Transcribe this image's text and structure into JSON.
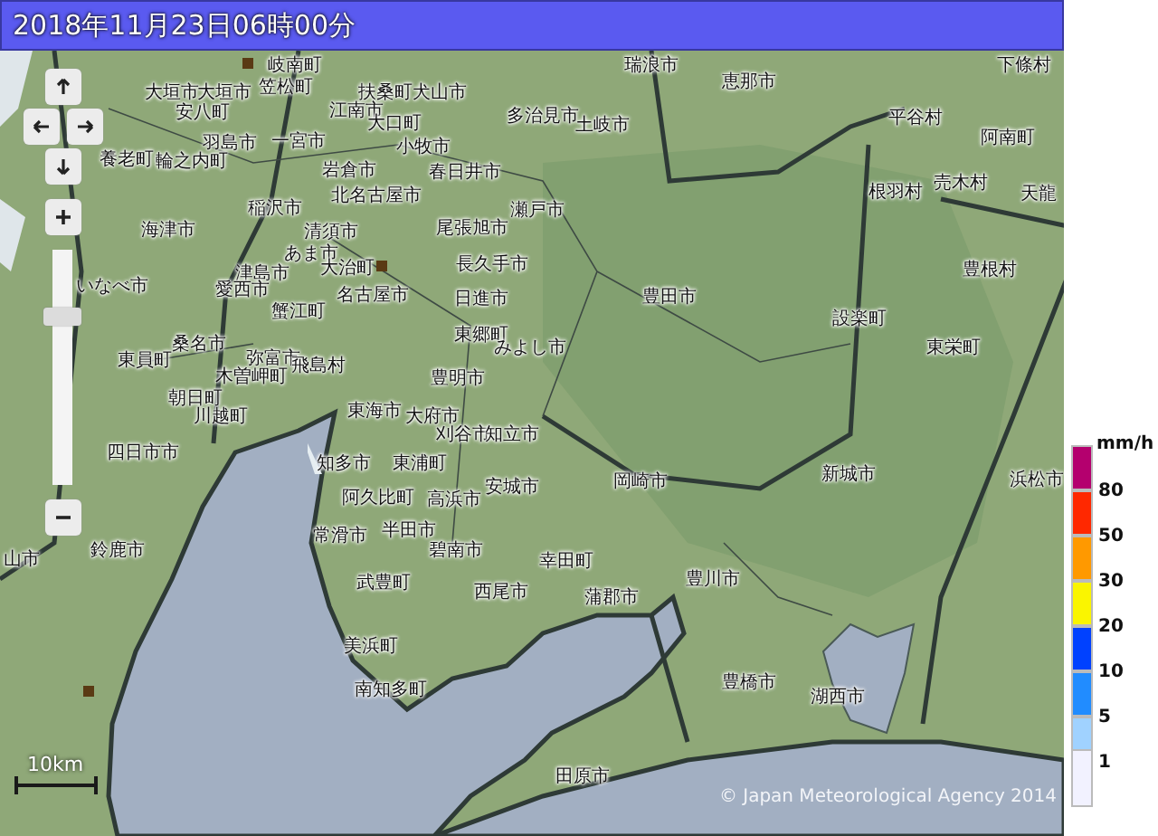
{
  "title": "2018年11月23日06時00分",
  "map": {
    "labels": [
      "岐南町",
      "瑞浪市",
      "下條村",
      "大垣市",
      "大垣市",
      "笠松町",
      "扶桑町",
      "犬山市",
      "恵那市",
      "安八町",
      "江南市",
      "大口町",
      "多治見市",
      "土岐市",
      "平谷村",
      "羽島市",
      "一宮市",
      "小牧市",
      "阿南町",
      "養老町",
      "輪之内町",
      "岩倉市",
      "春日井市",
      "北名古屋市",
      "根羽村",
      "売木村",
      "天龍",
      "稲沢市",
      "瀬戸市",
      "海津市",
      "清須市",
      "尾張旭市",
      "あま市",
      "津島市",
      "大治町",
      "長久手市",
      "豊根村",
      "いなべ市",
      "愛西市",
      "名古屋市",
      "日進市",
      "豊田市",
      "蟹江町",
      "設楽町",
      "桑名市",
      "東郷町",
      "みよし市",
      "東栄町",
      "東員町",
      "弥富市",
      "飛島村",
      "木曽岬町",
      "豊明市",
      "朝日町",
      "川越町",
      "東海市",
      "大府市",
      "刈谷市",
      "知立市",
      "四日市市",
      "知多市",
      "東浦町",
      "安城市",
      "岡崎市",
      "新城市",
      "浜松市",
      "阿久比町",
      "高浜市",
      "常滑市",
      "半田市",
      "山市",
      "鈴鹿市",
      "碧南市",
      "幸田町",
      "武豊町",
      "西尾市",
      "蒲郡市",
      "豊川市",
      "美浜町",
      "南知多町",
      "豊橋市",
      "湖西市",
      "田原市"
    ],
    "zoom_slider": {
      "level": 0.73
    },
    "scale": "10km",
    "copyright": "© Japan Meteorological Agency 2014"
  },
  "legend": {
    "unit": "mm/h",
    "items": [
      {
        "color": "#b4006e",
        "label": "80"
      },
      {
        "color": "#ff2800",
        "label": "50"
      },
      {
        "color": "#ff9900",
        "label": "30"
      },
      {
        "color": "#faf500",
        "label": "20"
      },
      {
        "color": "#0041ff",
        "label": "10"
      },
      {
        "color": "#218cff",
        "label": "5"
      },
      {
        "color": "#a0d2ff",
        "label": "1"
      },
      {
        "color": "#f2f2ff"
      }
    ]
  }
}
